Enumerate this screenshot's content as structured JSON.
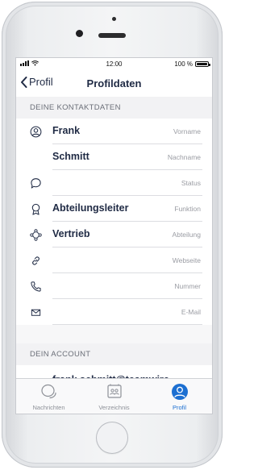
{
  "status_bar": {
    "time": "12:00",
    "battery": "100 %"
  },
  "nav": {
    "back_label": "Profil",
    "title": "Profildaten"
  },
  "sections": {
    "contact_header": "DEINE KONTAKTDATEN",
    "account_header": "DEIN ACCOUNT"
  },
  "fields": [
    {
      "icon": "person-icon",
      "value": "Frank",
      "label": "Vorname"
    },
    {
      "icon": "",
      "value": "Schmitt",
      "label": "Nachname"
    },
    {
      "icon": "speech-bubble-icon",
      "value": "",
      "label": "Status"
    },
    {
      "icon": "badge-icon",
      "value": "Abteilungsleiter",
      "label": "Funktion"
    },
    {
      "icon": "network-icon",
      "value": "Vertrieb",
      "label": "Abteilung"
    },
    {
      "icon": "link-icon",
      "value": "",
      "label": "Webseite"
    },
    {
      "icon": "phone-icon",
      "value": "",
      "label": "Nummer"
    },
    {
      "icon": "envelope-icon",
      "value": "",
      "label": "E-Mail"
    }
  ],
  "account": {
    "username": "frank.schmitt@teamwire"
  },
  "tabs": [
    {
      "label": "Nachrichten",
      "icon": "chat-icon",
      "active": false
    },
    {
      "label": "Verzeichnis",
      "icon": "directory-icon",
      "active": false
    },
    {
      "label": "Profil",
      "icon": "profile-icon",
      "active": true
    }
  ],
  "colors": {
    "accent": "#1c6fd1",
    "text_dark": "#1f2a44",
    "label_gray": "#9a9ca3",
    "section_bg": "#f2f2f4"
  }
}
